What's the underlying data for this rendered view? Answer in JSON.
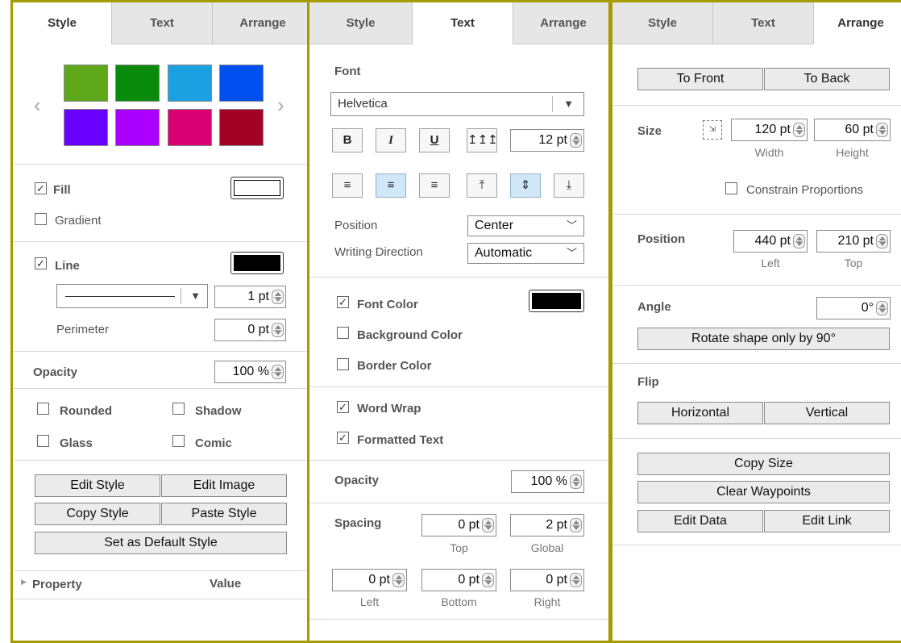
{
  "colors": {
    "accent_border": "#a59a00",
    "fill_swatch": "#ffffff",
    "line_swatch": "#000000",
    "font_swatch": "#000000"
  },
  "style_panel": {
    "tabs": [
      "Style",
      "Text",
      "Arrange"
    ],
    "swatches": [
      "#5ea61a",
      "#0a8a0a",
      "#1ba1e2",
      "#0050ef",
      "#6a00ff",
      "#aa00ff",
      "#d80073",
      "#a20025"
    ],
    "fill": {
      "label": "Fill",
      "checked": "✓"
    },
    "gradient": {
      "label": "Gradient"
    },
    "line": {
      "label": "Line",
      "checked": "✓",
      "width": "1 pt"
    },
    "perimeter": {
      "label": "Perimeter",
      "value": "0 pt"
    },
    "opacity": {
      "label": "Opacity",
      "value": "100 %"
    },
    "options": {
      "rounded": "Rounded",
      "shadow": "Shadow",
      "glass": "Glass",
      "comic": "Comic"
    },
    "buttons": {
      "edit_style": "Edit Style",
      "edit_image": "Edit Image",
      "copy_style": "Copy Style",
      "paste_style": "Paste Style",
      "set_default": "Set as Default Style"
    },
    "props": {
      "property": "Property",
      "value": "Value"
    }
  },
  "text_panel": {
    "tabs": [
      "Style",
      "Text",
      "Arrange"
    ],
    "font_label": "Font",
    "font_family": "Helvetica",
    "font_size": "12 pt",
    "bold": "B",
    "italic": "I",
    "underline": "U",
    "position": {
      "label": "Position",
      "value": "Center"
    },
    "writing_direction": {
      "label": "Writing Direction",
      "value": "Automatic"
    },
    "font_color": {
      "label": "Font Color",
      "checked": "✓"
    },
    "background_color": {
      "label": "Background Color"
    },
    "border_color": {
      "label": "Border Color"
    },
    "word_wrap": {
      "label": "Word Wrap",
      "checked": "✓"
    },
    "formatted_text": {
      "label": "Formatted Text",
      "checked": "✓"
    },
    "opacity": {
      "label": "Opacity",
      "value": "100 %"
    },
    "spacing": {
      "label": "Spacing",
      "top": {
        "value": "0 pt",
        "caption": "Top"
      },
      "global": {
        "value": "2 pt",
        "caption": "Global"
      },
      "left": {
        "value": "0 pt",
        "caption": "Left"
      },
      "bottom": {
        "value": "0 pt",
        "caption": "Bottom"
      },
      "right": {
        "value": "0 pt",
        "caption": "Right"
      }
    }
  },
  "arrange_panel": {
    "tabs": [
      "Style",
      "Text",
      "Arrange"
    ],
    "to_front": "To Front",
    "to_back": "To Back",
    "size": {
      "label": "Size",
      "width": "120 pt",
      "height": "60 pt",
      "width_caption": "Width",
      "height_caption": "Height"
    },
    "constrain": "Constrain Proportions",
    "position": {
      "label": "Position",
      "left": "440 pt",
      "top": "210 pt",
      "left_caption": "Left",
      "top_caption": "Top"
    },
    "angle": {
      "label": "Angle",
      "value": "0°"
    },
    "rotate": "Rotate shape only by 90°",
    "flip": {
      "label": "Flip",
      "horizontal": "Horizontal",
      "vertical": "Vertical"
    },
    "copy_size": "Copy Size",
    "clear_waypoints": "Clear Waypoints",
    "edit_data": "Edit Data",
    "edit_link": "Edit Link"
  }
}
